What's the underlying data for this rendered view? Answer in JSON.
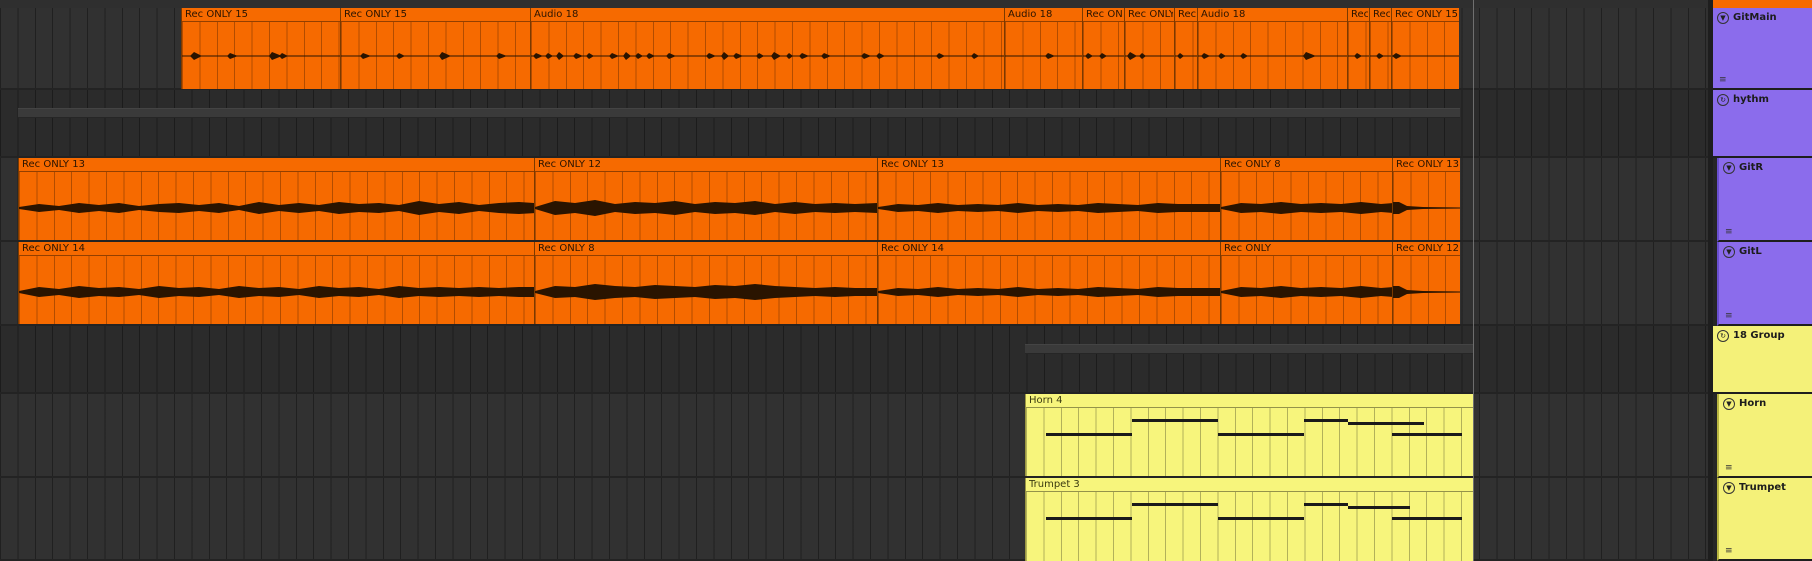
{
  "colors": {
    "audio_clip": "#f66a00",
    "midi_clip": "#f7f57c",
    "gitmain_track": "#8b6cec",
    "horn_group": "#f4f179"
  },
  "tracks": [
    {
      "name": "GitMain",
      "type": "audio",
      "color": "#8b6cec",
      "clips": [
        {
          "label": "Rec ONLY 15"
        },
        {
          "label": "Rec ONLY 15"
        },
        {
          "label": "Audio 18"
        },
        {
          "label": "Audio 18"
        },
        {
          "label": "Rec ONL"
        },
        {
          "label": "Rec ONLY"
        },
        {
          "label": "Rec"
        },
        {
          "label": "Audio 18"
        },
        {
          "label": "Rec"
        },
        {
          "label": "Rec"
        },
        {
          "label": "Rec ONLY 15"
        }
      ]
    },
    {
      "name": "hythm",
      "type": "group",
      "color": "#8b6cec",
      "clips": []
    },
    {
      "name": "GitR",
      "type": "audio",
      "color": "#8b6cec",
      "clips": [
        {
          "label": "Rec ONLY 13"
        },
        {
          "label": "Rec ONLY 12"
        },
        {
          "label": "Rec ONLY 13"
        },
        {
          "label": "Rec ONLY 8"
        },
        {
          "label": "Rec ONLY 13"
        }
      ]
    },
    {
      "name": "GitL",
      "type": "audio",
      "color": "#8b6cec",
      "clips": [
        {
          "label": "Rec ONLY 14"
        },
        {
          "label": "Rec ONLY 8"
        },
        {
          "label": "Rec ONLY 14"
        },
        {
          "label": "Rec ONLY"
        },
        {
          "label": "Rec ONLY 12"
        }
      ]
    },
    {
      "name": "18 Group",
      "type": "group",
      "color": "#f4f179",
      "clips": []
    },
    {
      "name": "Horn",
      "type": "midi",
      "color": "#f4f179",
      "clips": [
        {
          "label": "Horn 4"
        }
      ]
    },
    {
      "name": "Trumpet",
      "type": "midi",
      "color": "#f4f179",
      "clips": [
        {
          "label": "Trumpet 3"
        }
      ]
    }
  ]
}
